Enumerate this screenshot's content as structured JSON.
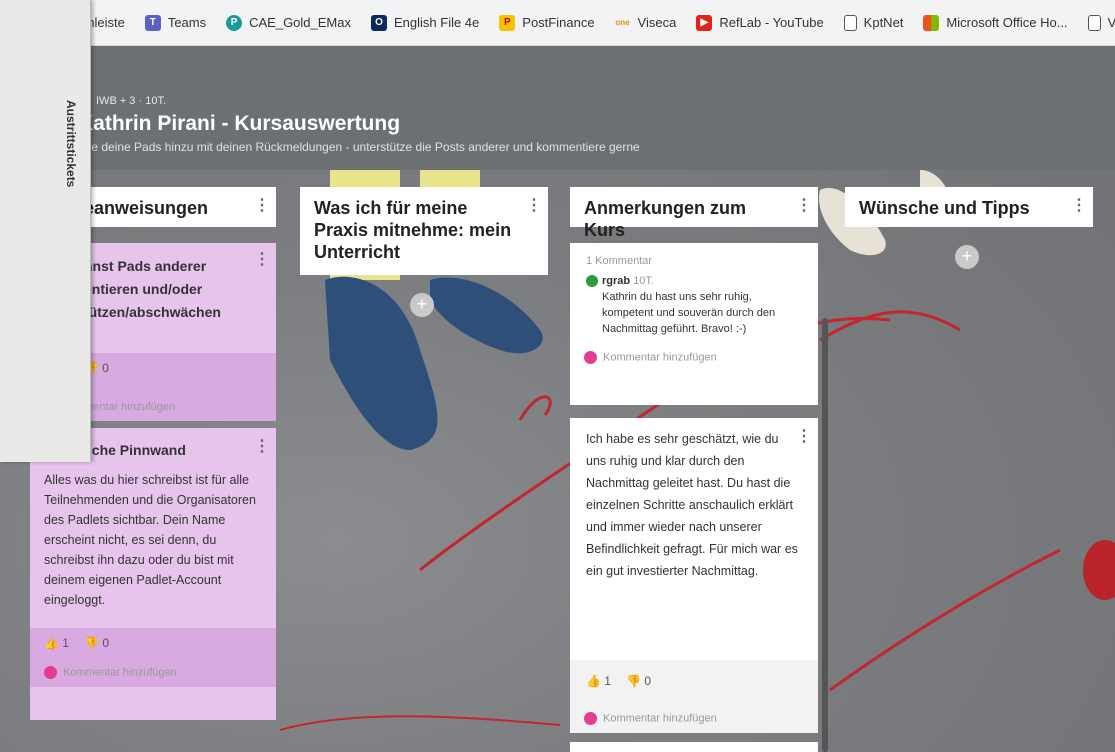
{
  "bookmarks": [
    {
      "label": "enleiste",
      "icon": "none",
      "color": "#f1f3f4"
    },
    {
      "label": "Teams",
      "icon": "teams-icon",
      "color": "#5b5fc7"
    },
    {
      "label": "CAE_Gold_EMax",
      "icon": "pinterest-icon",
      "color": "#1a9b9b"
    },
    {
      "label": "English File 4e",
      "icon": "oxford-icon",
      "color": "#0a2a5c"
    },
    {
      "label": "PostFinance",
      "icon": "postfinance-icon",
      "color": "#f5c400"
    },
    {
      "label": "Viseca",
      "icon": "viseca-icon",
      "color": "#f08c00"
    },
    {
      "label": "RefLab - YouTube",
      "icon": "youtube-icon",
      "color": "#e62117"
    },
    {
      "label": "KptNet",
      "icon": "page-icon",
      "color": "#ffffff"
    },
    {
      "label": "Microsoft Office Ho...",
      "icon": "microsoft-icon",
      "color": "#f25022"
    },
    {
      "label": "Ve",
      "icon": "page-icon",
      "color": "#ffffff"
    }
  ],
  "header": {
    "meta": "IWB + 3 · 10T.",
    "title": "Kathrin Pirani - Kursauswertung",
    "subtitle": "üge deine Pads hinzu mit deinen Rückmeldungen - unterstütze die Posts anderer und kommentiere gerne"
  },
  "sidebar_paper": {
    "text": "Austrittstickets"
  },
  "columns": [
    {
      "title": "eanweisungen"
    },
    {
      "title": "Was ich für meine Praxis mitnehme: mein Unterricht"
    },
    {
      "title": "Anmerkungen zum Kurs"
    },
    {
      "title": "Wünsche und Tipps"
    }
  ],
  "col1": {
    "card1": {
      "text": "nnst Pads anderer entieren und/oder tützen/abschwächen",
      "dislikes": "0",
      "add_comment": "mentar hinzufügen"
    },
    "card2": {
      "title": "liche Pinnwand",
      "text": "Alles was du hier schreibst  ist für alle Teilnehmenden und die Organisatoren des Padlets sichtbar. Dein Name erscheint nicht, es sei denn, du schreibst ihn dazu oder du bist mit deinem eigenen Padlet-Account eingeloggt.",
      "likes": "1",
      "dislikes": "0",
      "add_comment": "Kommentar hinzufügen"
    }
  },
  "col3": {
    "card1": {
      "comment_count": "1 Kommentar",
      "comment_author": "rgrab",
      "comment_time": "10T.",
      "comment_text": "Kathrin du hast uns sehr ruhig, kompetent und souverän durch den Nachmittag geführt. Bravo! :-)",
      "add_comment": "Kommentar hinzufügen"
    },
    "card2": {
      "text": "Ich habe es sehr geschätzt, wie du uns ruhig und klar durch den Nachmittag geleitet hast. Du hast die einzelnen Schritte anschaulich erklärt und immer wieder nach unserer Befindlichkeit gefragt. Für mich war es ein gut investierter Nachmittag.",
      "likes": "1",
      "dislikes": "0",
      "add_comment": "Kommentar hinzufügen"
    }
  },
  "colors": {
    "pink_card": "#e6c4ec",
    "pink_footer": "#d9a9e2",
    "avatar": "#e23d8e",
    "yarn": "#d9232a"
  }
}
